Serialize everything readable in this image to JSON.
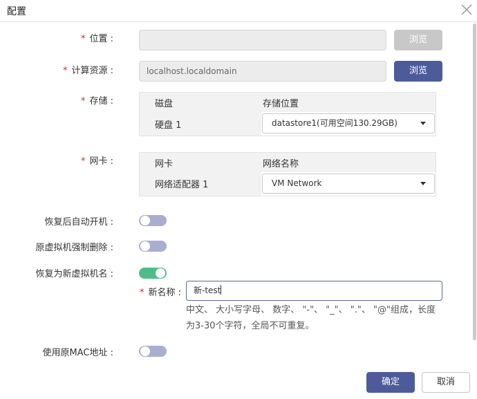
{
  "dialog": {
    "title": "配置"
  },
  "form": {
    "location": {
      "label": "位置 :",
      "value": "",
      "browse_label": "浏览"
    },
    "compute": {
      "label": "计算资源 :",
      "value": "localhost.localdomain",
      "browse_label": "浏览"
    },
    "storage": {
      "label": "存储 :",
      "headers": [
        "磁盘",
        "存储位置"
      ],
      "rows": [
        {
          "disk": "硬盘 1",
          "location": "datastore1(可用空间130.29GB)"
        }
      ]
    },
    "nic": {
      "label": "网卡 :",
      "headers": [
        "网卡",
        "网络名称"
      ],
      "rows": [
        {
          "nic": "网络适配器 1",
          "network": "VM Network"
        }
      ]
    },
    "auto_power_on": {
      "label": "恢复后自动开机 :",
      "on": false
    },
    "force_delete": {
      "label": "原虚拟机强制删除 :",
      "on": false
    },
    "restore_as_new": {
      "label": "恢复为新虚拟机名 :",
      "on": true
    },
    "new_name": {
      "label": "新名称 :",
      "value": "新-test",
      "hint": "中文、 大小写字母、 数字、 \"-\"、 \"_\"、 \".\"、 \"@\"组成，长度为3-30个字符，全局不可重复。"
    },
    "use_original_mac": {
      "label": "使用原MAC地址 :",
      "on": false
    }
  },
  "footer": {
    "confirm_label": "确定",
    "cancel_label": "取消"
  },
  "colors": {
    "primary": "#4e5b9a",
    "toggle_on": "#4dbd87",
    "toggle_off": "#a9aed1",
    "required": "#e0281b"
  }
}
